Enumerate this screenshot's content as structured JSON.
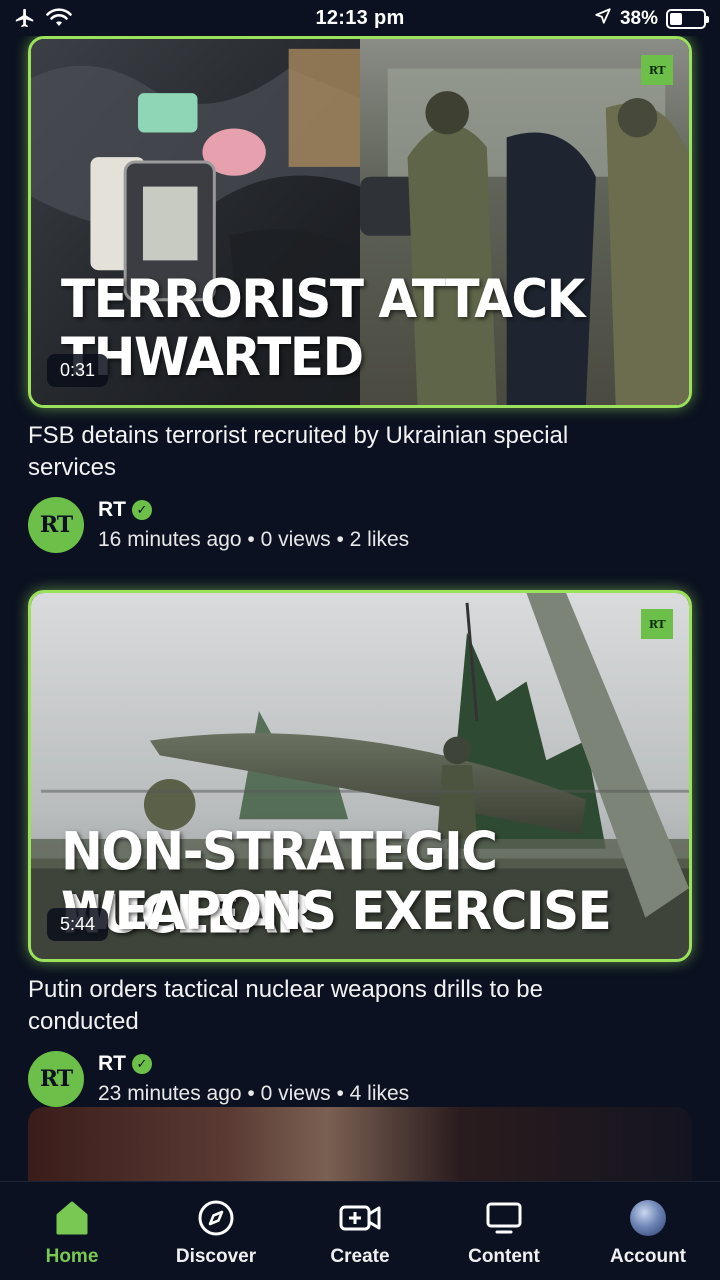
{
  "status_bar": {
    "time": "12:13 pm",
    "battery_percent": "38%",
    "battery_level": 0.38,
    "icons": [
      "airplane-icon",
      "wifi-icon",
      "location-arrow-icon",
      "battery-icon"
    ]
  },
  "feed": {
    "videos": [
      {
        "thumbnail_headline_lines": [
          "TERRORIST ATTACK",
          "THWARTED"
        ],
        "thumbnail_badge": "RT",
        "duration": "0:31",
        "title": "FSB detains terrorist recruited by Ukrainian special services",
        "channel": "RT",
        "avatar_text": "RT",
        "verified": true,
        "stats": "16 minutes ago • 0 views • 2 likes"
      },
      {
        "thumbnail_headline_lines": [
          "NON-STRATEGIC NUCLEAR",
          "WEAPONS EXERCISE"
        ],
        "thumbnail_badge": "RT",
        "duration": "5:44",
        "title": "Putin orders tactical nuclear weapons drills to be conducted",
        "channel": "RT",
        "avatar_text": "RT",
        "verified": true,
        "stats": "23 minutes ago • 0 views • 4 likes"
      }
    ]
  },
  "bottom_nav": {
    "items": [
      {
        "label": "Home",
        "icon": "home-icon",
        "active": true
      },
      {
        "label": "Discover",
        "icon": "compass-icon",
        "active": false
      },
      {
        "label": "Create",
        "icon": "video-add-icon",
        "active": false
      },
      {
        "label": "Content",
        "icon": "monitor-icon",
        "active": false
      },
      {
        "label": "Account",
        "icon": "account-avatar",
        "active": false
      }
    ]
  },
  "colors": {
    "background": "#0b1120",
    "accent_green": "#79c853",
    "rt_green": "#6cc04a"
  }
}
